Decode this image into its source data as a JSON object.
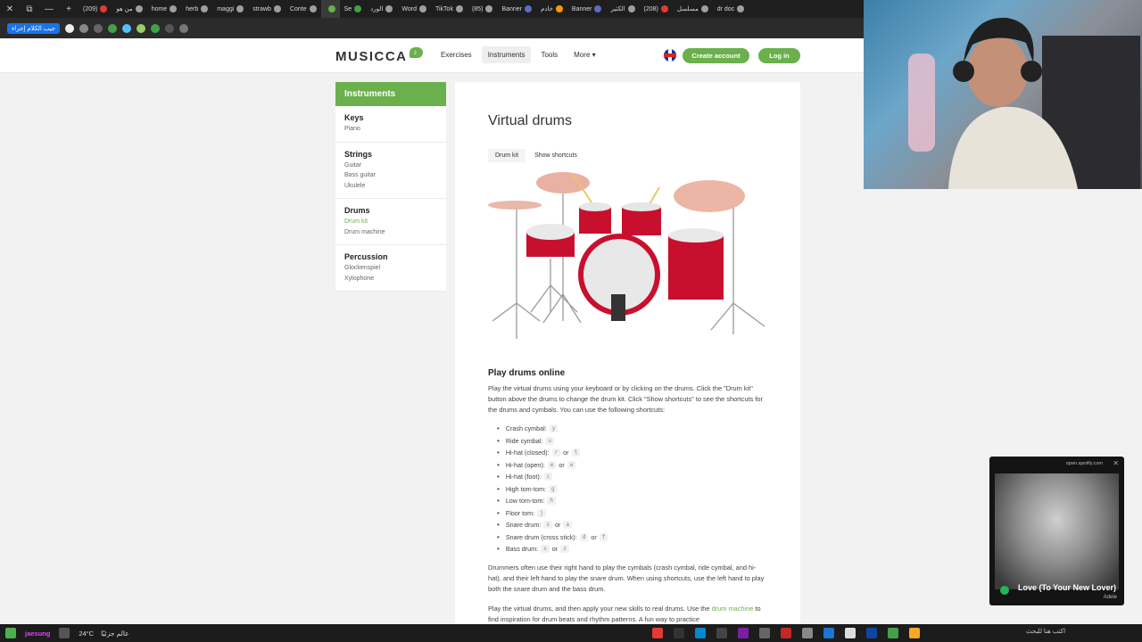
{
  "browser": {
    "tabs": [
      {
        "label": "(209)",
        "color": "#e53935"
      },
      {
        "label": "من هو",
        "color": "#9e9e9e"
      },
      {
        "label": "home",
        "color": "#9e9e9e"
      },
      {
        "label": "herb",
        "color": "#9e9e9e"
      },
      {
        "label": "maggi",
        "color": "#9e9e9e"
      },
      {
        "label": "strawb",
        "color": "#9e9e9e"
      },
      {
        "label": "Conte",
        "color": "#9e9e9e"
      },
      {
        "label": "",
        "color": "#6ab04c",
        "active": true
      },
      {
        "label": "Se",
        "color": "#43a047"
      },
      {
        "label": "الورد",
        "color": "#9e9e9e"
      },
      {
        "label": "Word",
        "color": "#9e9e9e"
      },
      {
        "label": "TikTok",
        "color": "#9e9e9e"
      },
      {
        "label": "(85)",
        "color": "#9e9e9e"
      },
      {
        "label": "Banner",
        "color": "#5c6bc0"
      },
      {
        "label": "خادم",
        "color": "#ff9800"
      },
      {
        "label": "Banner",
        "color": "#5c6bc0"
      },
      {
        "label": "الكثير",
        "color": "#9e9e9e"
      },
      {
        "label": "(208)",
        "color": "#e53935"
      },
      {
        "label": "مسلسل",
        "color": "#9e9e9e"
      },
      {
        "label": "dr doc",
        "color": "#9e9e9e"
      }
    ],
    "bookmark_pill": "جيب الكلام إجراء"
  },
  "header": {
    "logo": "MUSICCA",
    "nav": [
      "Exercises",
      "Instruments",
      "Tools",
      "More ▾"
    ],
    "active_nav": "Instruments",
    "create_account": "Create account",
    "login": "Log in"
  },
  "sidebar": {
    "title": "Instruments",
    "groups": [
      {
        "title": "Keys",
        "items": [
          "Piano"
        ]
      },
      {
        "title": "Strings",
        "items": [
          "Guitar",
          "Bass guitar",
          "Ukulele"
        ]
      },
      {
        "title": "Drums",
        "items": [
          "Drum kit",
          "Drum machine"
        ]
      },
      {
        "title": "Percussion",
        "items": [
          "Glockenspiel",
          "Xylophone"
        ]
      }
    ],
    "active_item": "Drum kit"
  },
  "main": {
    "title": "Virtual drums",
    "tab_drum_kit": "Drum kit",
    "tab_show_shortcuts": "Show shortcuts",
    "section_title": "Play drums online",
    "intro": "Play the virtual drums using your keyboard or by clicking on the drums. Click the \"Drum kit\" button above the drums to change the drum kit. Click \"Show shortcuts\" to see the shortcuts for the drums and cymbals. You can use the following shortcuts:",
    "shortcuts": [
      {
        "label": "Crash cymbal:",
        "keys": [
          "y"
        ]
      },
      {
        "label": "Ride cymbal:",
        "keys": [
          "u"
        ]
      },
      {
        "label": "Hi-hat (closed):",
        "keys": [
          "r",
          "t"
        ]
      },
      {
        "label": "Hi-hat (open):",
        "keys": [
          "e",
          "w"
        ]
      },
      {
        "label": "Hi-hat (foot):",
        "keys": [
          "c"
        ]
      },
      {
        "label": "High tom-tom:",
        "keys": [
          "g"
        ]
      },
      {
        "label": "Low tom-tom:",
        "keys": [
          "h"
        ]
      },
      {
        "label": "Floor tom:",
        "keys": [
          "j"
        ]
      },
      {
        "label": "Snare drum:",
        "keys": [
          "s",
          "a"
        ]
      },
      {
        "label": "Snare drum (cross stick):",
        "keys": [
          "d",
          "f"
        ]
      },
      {
        "label": "Bass drum:",
        "keys": [
          "x",
          "z"
        ]
      }
    ],
    "or_word": "or",
    "para2": "Drummers often use their right hand to play the cymbals (crash cymbal, ride cymbal, and hi-hat), and their left hand to play the snare drum. When using shortcuts, use the left hand to play both the snare drum and the bass drum.",
    "para3_before": "Play the virtual drums, and then apply your new skills to real drums. Use the",
    "para3_link": "drum machine",
    "para3_after": "to find inspiration for drum beats and rhythm patterns. A fun way to practice"
  },
  "spotify": {
    "url": "open.spotify.com",
    "song": "Love (To Your New Lover)",
    "artist": "Adele"
  },
  "taskbar": {
    "user": "jaesung",
    "weather": "24°C",
    "weather_label": "عالم جزئيًا",
    "search": "اكتب هنا للبحث"
  }
}
